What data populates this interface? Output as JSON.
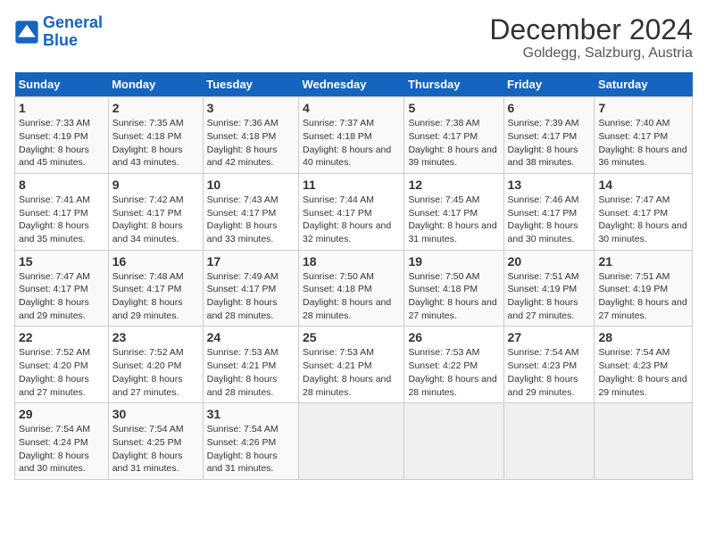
{
  "header": {
    "logo_line1": "General",
    "logo_line2": "Blue",
    "title": "December 2024",
    "subtitle": "Goldegg, Salzburg, Austria"
  },
  "days_of_week": [
    "Sunday",
    "Monday",
    "Tuesday",
    "Wednesday",
    "Thursday",
    "Friday",
    "Saturday"
  ],
  "weeks": [
    [
      {
        "day": "1",
        "info": "Sunrise: 7:33 AM\nSunset: 4:19 PM\nDaylight: 8 hours and 45 minutes."
      },
      {
        "day": "2",
        "info": "Sunrise: 7:35 AM\nSunset: 4:18 PM\nDaylight: 8 hours and 43 minutes."
      },
      {
        "day": "3",
        "info": "Sunrise: 7:36 AM\nSunset: 4:18 PM\nDaylight: 8 hours and 42 minutes."
      },
      {
        "day": "4",
        "info": "Sunrise: 7:37 AM\nSunset: 4:18 PM\nDaylight: 8 hours and 40 minutes."
      },
      {
        "day": "5",
        "info": "Sunrise: 7:38 AM\nSunset: 4:17 PM\nDaylight: 8 hours and 39 minutes."
      },
      {
        "day": "6",
        "info": "Sunrise: 7:39 AM\nSunset: 4:17 PM\nDaylight: 8 hours and 38 minutes."
      },
      {
        "day": "7",
        "info": "Sunrise: 7:40 AM\nSunset: 4:17 PM\nDaylight: 8 hours and 36 minutes."
      }
    ],
    [
      {
        "day": "8",
        "info": "Sunrise: 7:41 AM\nSunset: 4:17 PM\nDaylight: 8 hours and 35 minutes."
      },
      {
        "day": "9",
        "info": "Sunrise: 7:42 AM\nSunset: 4:17 PM\nDaylight: 8 hours and 34 minutes."
      },
      {
        "day": "10",
        "info": "Sunrise: 7:43 AM\nSunset: 4:17 PM\nDaylight: 8 hours and 33 minutes."
      },
      {
        "day": "11",
        "info": "Sunrise: 7:44 AM\nSunset: 4:17 PM\nDaylight: 8 hours and 32 minutes."
      },
      {
        "day": "12",
        "info": "Sunrise: 7:45 AM\nSunset: 4:17 PM\nDaylight: 8 hours and 31 minutes."
      },
      {
        "day": "13",
        "info": "Sunrise: 7:46 AM\nSunset: 4:17 PM\nDaylight: 8 hours and 30 minutes."
      },
      {
        "day": "14",
        "info": "Sunrise: 7:47 AM\nSunset: 4:17 PM\nDaylight: 8 hours and 30 minutes."
      }
    ],
    [
      {
        "day": "15",
        "info": "Sunrise: 7:47 AM\nSunset: 4:17 PM\nDaylight: 8 hours and 29 minutes."
      },
      {
        "day": "16",
        "info": "Sunrise: 7:48 AM\nSunset: 4:17 PM\nDaylight: 8 hours and 29 minutes."
      },
      {
        "day": "17",
        "info": "Sunrise: 7:49 AM\nSunset: 4:17 PM\nDaylight: 8 hours and 28 minutes."
      },
      {
        "day": "18",
        "info": "Sunrise: 7:50 AM\nSunset: 4:18 PM\nDaylight: 8 hours and 28 minutes."
      },
      {
        "day": "19",
        "info": "Sunrise: 7:50 AM\nSunset: 4:18 PM\nDaylight: 8 hours and 27 minutes."
      },
      {
        "day": "20",
        "info": "Sunrise: 7:51 AM\nSunset: 4:19 PM\nDaylight: 8 hours and 27 minutes."
      },
      {
        "day": "21",
        "info": "Sunrise: 7:51 AM\nSunset: 4:19 PM\nDaylight: 8 hours and 27 minutes."
      }
    ],
    [
      {
        "day": "22",
        "info": "Sunrise: 7:52 AM\nSunset: 4:20 PM\nDaylight: 8 hours and 27 minutes."
      },
      {
        "day": "23",
        "info": "Sunrise: 7:52 AM\nSunset: 4:20 PM\nDaylight: 8 hours and 27 minutes."
      },
      {
        "day": "24",
        "info": "Sunrise: 7:53 AM\nSunset: 4:21 PM\nDaylight: 8 hours and 28 minutes."
      },
      {
        "day": "25",
        "info": "Sunrise: 7:53 AM\nSunset: 4:21 PM\nDaylight: 8 hours and 28 minutes."
      },
      {
        "day": "26",
        "info": "Sunrise: 7:53 AM\nSunset: 4:22 PM\nDaylight: 8 hours and 28 minutes."
      },
      {
        "day": "27",
        "info": "Sunrise: 7:54 AM\nSunset: 4:23 PM\nDaylight: 8 hours and 29 minutes."
      },
      {
        "day": "28",
        "info": "Sunrise: 7:54 AM\nSunset: 4:23 PM\nDaylight: 8 hours and 29 minutes."
      }
    ],
    [
      {
        "day": "29",
        "info": "Sunrise: 7:54 AM\nSunset: 4:24 PM\nDaylight: 8 hours and 30 minutes."
      },
      {
        "day": "30",
        "info": "Sunrise: 7:54 AM\nSunset: 4:25 PM\nDaylight: 8 hours and 31 minutes."
      },
      {
        "day": "31",
        "info": "Sunrise: 7:54 AM\nSunset: 4:26 PM\nDaylight: 8 hours and 31 minutes."
      },
      null,
      null,
      null,
      null
    ]
  ]
}
